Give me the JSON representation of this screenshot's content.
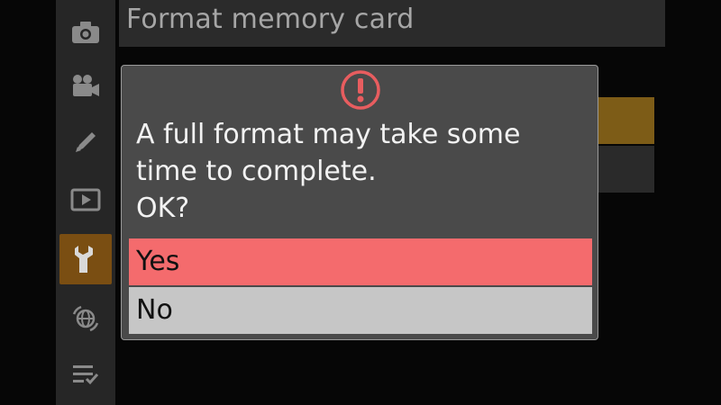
{
  "menu": {
    "title": "Format memory card"
  },
  "rail": {
    "items": [
      {
        "icon": "camera-icon",
        "active": false
      },
      {
        "icon": "movie-camera-icon",
        "active": false
      },
      {
        "icon": "pencil-icon",
        "active": false
      },
      {
        "icon": "playback-icon",
        "active": false
      },
      {
        "icon": "wrench-icon",
        "active": true
      },
      {
        "icon": "network-icon",
        "active": false
      },
      {
        "icon": "my-menu-icon",
        "active": false
      }
    ]
  },
  "dialog": {
    "icon": "warning-icon",
    "lines": [
      "A full format may take some",
      "time to complete.",
      "OK?"
    ],
    "options": [
      {
        "label": "Yes",
        "selected": true
      },
      {
        "label": "No",
        "selected": false
      }
    ]
  },
  "colors": {
    "selected_option": "#f46b6d",
    "unselected_option": "#c6c6c6",
    "warning": "#e85d5f",
    "rail_active": "#7a4e12"
  }
}
